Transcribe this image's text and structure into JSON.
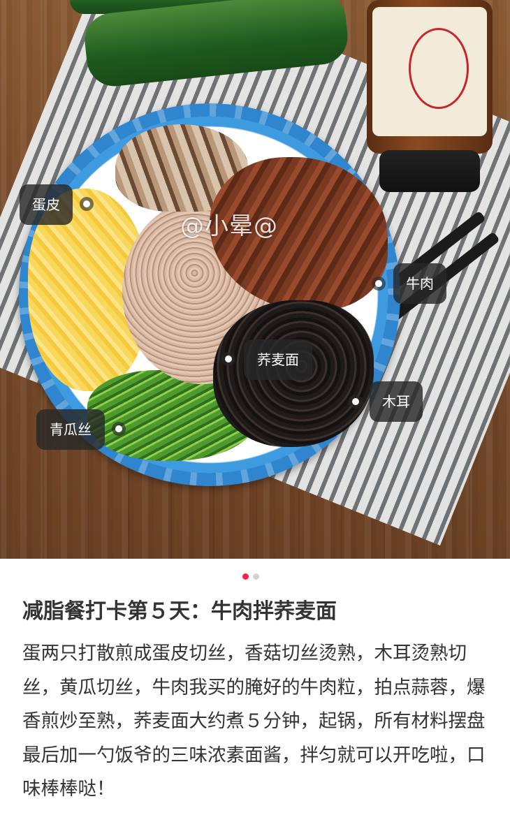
{
  "photo": {
    "watermark": "@小晕@",
    "tags": [
      {
        "id": "egg",
        "label": "蛋皮"
      },
      {
        "id": "beef",
        "label": "牛肉"
      },
      {
        "id": "buckwheat",
        "label": "荞麦面"
      },
      {
        "id": "fungus",
        "label": "木耳"
      },
      {
        "id": "cucumber",
        "label": "青瓜丝"
      }
    ],
    "pager": {
      "total": 2,
      "current": 1
    }
  },
  "post": {
    "title": "减脂餐打卡第５天：牛肉拌荞麦面",
    "paragraphs": [
      "蛋两只打散煎成蛋皮切丝，香菇切丝烫熟，木耳烫熟切丝，黄瓜切丝，牛肉我买的腌好的牛肉粒，拍点蒜蓉，爆香煎炒至熟，荞麦面大约煮５分钟，起锅，所有材料摆盘",
      "最后加一勺饭爷的三味浓素面酱，拌匀就可以开吃啦，口味棒棒哒！"
    ]
  },
  "colors": {
    "accent": "#ff2442",
    "tag_bg": "#282828",
    "text": "#333333"
  }
}
